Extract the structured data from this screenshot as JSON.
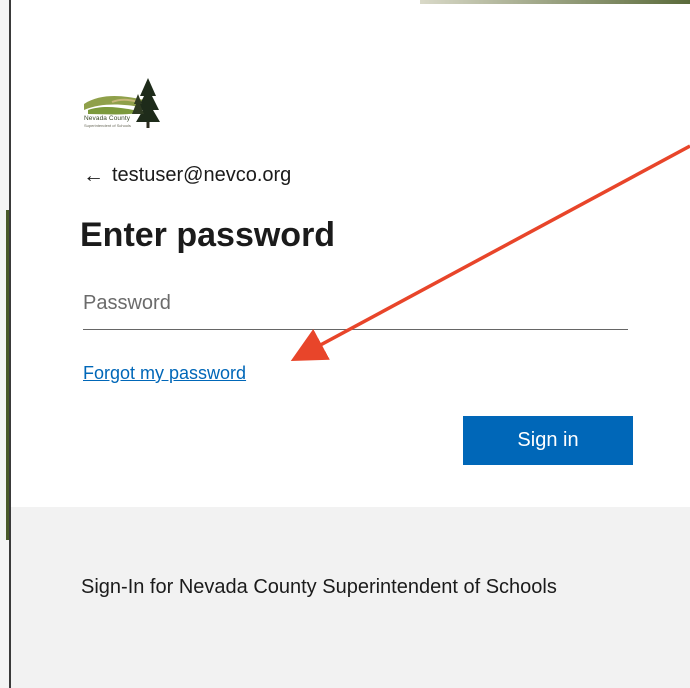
{
  "logo": {
    "name": "Nevada County",
    "subtitle": "Superintendent of Schools"
  },
  "account": {
    "back_icon": "arrow-left-icon",
    "email": "testuser@nevco.org"
  },
  "page": {
    "title": "Enter password"
  },
  "password": {
    "placeholder": "Password",
    "value": ""
  },
  "links": {
    "forgot": "Forgot my password"
  },
  "buttons": {
    "sign_in": "Sign in"
  },
  "footer": {
    "text": "Sign-In for Nevada County Superintendent of Schools"
  },
  "annotation": {
    "type": "arrow",
    "color": "#e8452a"
  },
  "colors": {
    "accent": "#0067b8",
    "footer_bg": "#f2f2f2"
  }
}
